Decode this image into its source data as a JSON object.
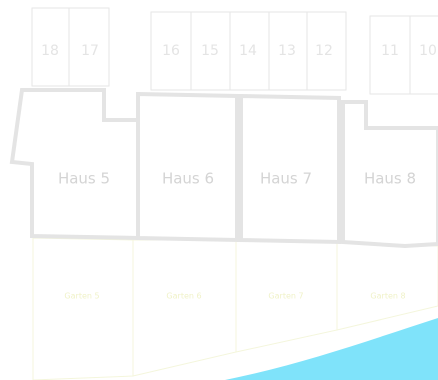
{
  "parking_spaces": [
    {
      "id": "p18",
      "label": "18"
    },
    {
      "id": "p17",
      "label": "17"
    },
    {
      "id": "p16",
      "label": "16"
    },
    {
      "id": "p15",
      "label": "15"
    },
    {
      "id": "p14",
      "label": "14"
    },
    {
      "id": "p13",
      "label": "13"
    },
    {
      "id": "p12",
      "label": "12"
    },
    {
      "id": "p11",
      "label": "11"
    },
    {
      "id": "p10",
      "label": "10"
    }
  ],
  "houses": [
    {
      "id": "haus5",
      "label": "Haus 5"
    },
    {
      "id": "haus6",
      "label": "Haus 6"
    },
    {
      "id": "haus7",
      "label": "Haus 7"
    },
    {
      "id": "haus8",
      "label": "Haus 8"
    }
  ],
  "gardens": [
    {
      "id": "garten5",
      "label": "Garten 5"
    },
    {
      "id": "garten6",
      "label": "Garten 6"
    },
    {
      "id": "garten7",
      "label": "Garten 7"
    },
    {
      "id": "garten8",
      "label": "Garten 8"
    }
  ],
  "colors": {
    "water": "#7fe3fa",
    "house_outline": "#e4e4e4",
    "house_label": "#d4d4d4",
    "parking_outline": "#e6e6e6",
    "garden_outline": "#f4f6dc"
  }
}
